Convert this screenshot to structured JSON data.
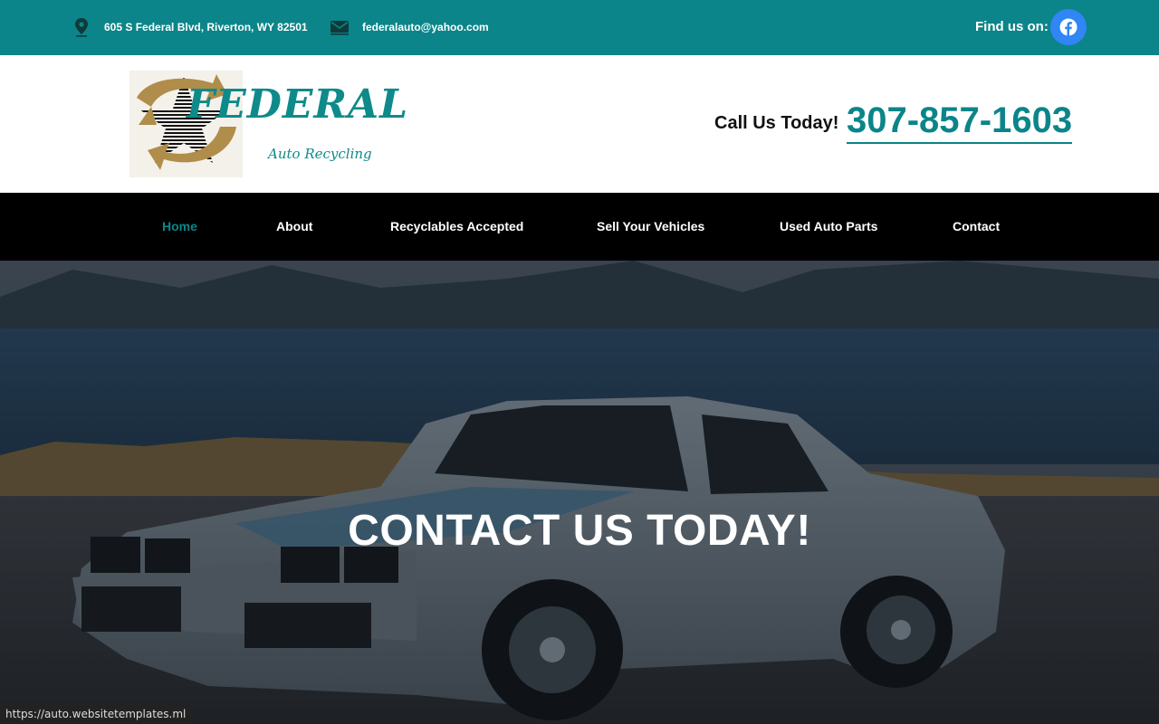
{
  "topbar": {
    "address": "605 S Federal Blvd, Riverton, WY 82501",
    "email": "federalauto@yahoo.com",
    "find_us": "Find us on:",
    "location_icon": "location-pin-icon",
    "mail_icon": "envelope-icon",
    "social_icon": "facebook-icon",
    "bg_color": "#0b8589",
    "facebook_color": "#2f86f4"
  },
  "header": {
    "logo": {
      "word": "FEDERAL",
      "tagline": "Auto Recycling"
    },
    "call_label": "Call Us Today!",
    "phone": "307-857-1603",
    "accent": "#0b8589"
  },
  "nav": {
    "items": [
      {
        "label": "Home",
        "active": true
      },
      {
        "label": "About",
        "active": false
      },
      {
        "label": "Recyclables Accepted",
        "active": false
      },
      {
        "label": "Sell Your Vehicles",
        "active": false
      },
      {
        "label": "Used Auto Parts",
        "active": false
      },
      {
        "label": "Contact",
        "active": false
      }
    ]
  },
  "hero": {
    "title": "CONTACT US TODAY!"
  },
  "status_bar": {
    "url": "https://auto.websitetemplates.ml"
  }
}
